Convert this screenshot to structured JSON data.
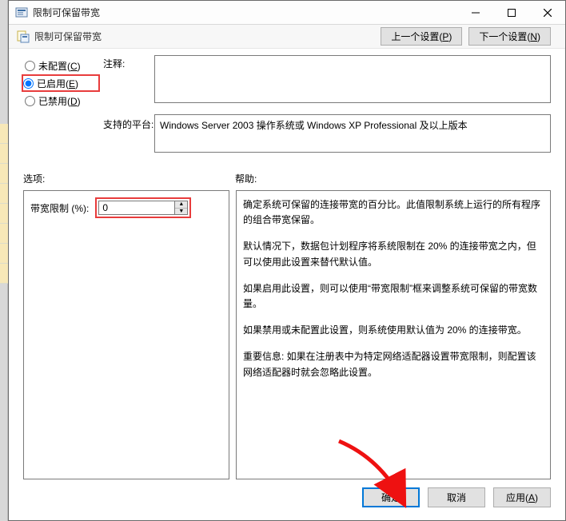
{
  "window": {
    "title": "限制可保留带宽"
  },
  "header": {
    "policy_name": "限制可保留带宽",
    "prev_button": "上一个设置(P)",
    "next_button": "下一个设置(N)"
  },
  "radios": {
    "not_configured_label": "未配置(",
    "not_configured_key": "C",
    "not_configured_suffix": ")",
    "enabled_label": "已启用(",
    "enabled_key": "E",
    "enabled_suffix": ")",
    "disabled_label": "已禁用(",
    "disabled_key": "D",
    "disabled_suffix": ")",
    "selected": "enabled"
  },
  "labels": {
    "note": "注释:",
    "platform": "支持的平台:",
    "options": "选项:",
    "help": "帮助:"
  },
  "note_value": "",
  "platform_value": "Windows Server 2003 操作系统或 Windows XP Professional 及以上版本",
  "options": {
    "bandwidth_label": "带宽限制 (%):",
    "bandwidth_value": "0"
  },
  "help_paragraphs": [
    "确定系统可保留的连接带宽的百分比。此值限制系统上运行的所有程序的组合带宽保留。",
    "默认情况下，数据包计划程序将系统限制在 20% 的连接带宽之内，但可以使用此设置来替代默认值。",
    "如果启用此设置，则可以使用“带宽限制”框来调整系统可保留的带宽数量。",
    "如果禁用或未配置此设置，则系统使用默认值为 20% 的连接带宽。",
    "重要信息: 如果在注册表中为特定网络适配器设置带宽限制，则配置该网络适配器时就会忽略此设置。"
  ],
  "footer": {
    "ok": "确定",
    "cancel": "取消",
    "apply": "应用(",
    "apply_key": "A",
    "apply_suffix": ")"
  }
}
